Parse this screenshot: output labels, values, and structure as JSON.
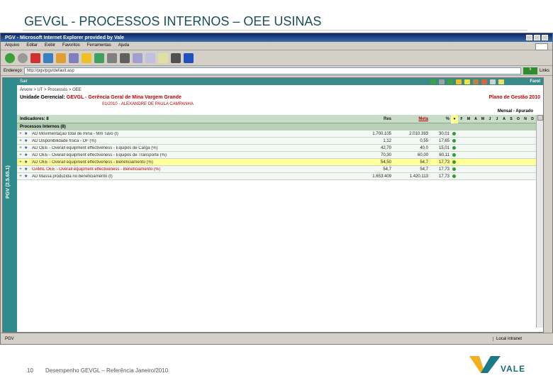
{
  "slide": {
    "title": "GEVGL - PROCESSOS INTERNOS – OEE USINAS",
    "page_number": "10",
    "footer_text": "Desempenho GEVGL – Referência Janeiro/2010",
    "logo_text": "VALE"
  },
  "browser": {
    "window_title": "PGV - Microsoft Internet Explorer provided by Vale",
    "menu": [
      "Arquivo",
      "Editar",
      "Exibir",
      "Favoritos",
      "Ferramentas",
      "Ajuda"
    ],
    "address_label": "Endereço",
    "address_value": "http://pgv/pgv/default.asp",
    "go_label": "Ir",
    "links_label": "Links",
    "status_left": "PGV",
    "status_zone": "Local intranet"
  },
  "app": {
    "side_label": "PGV (2.5.65.1)",
    "header_left": "Sair",
    "header_right": "Farol",
    "breadcrumb": "Árvore > UT > Processos > OEE",
    "unit_label": "Unidade Gerencial:",
    "unit_code": "GEVGL",
    "unit_name": "- Gerência Geral de Mina Vargem Grande",
    "person": "01/2010 - ALEXANDRE DE PAULA CAMPANHA",
    "plano": "Plano de Gestão 2010",
    "mensal": "Mensal - Apurado",
    "indicadores_label": "Indicadores: 8",
    "col_res": "Res",
    "col_meta": "Meta",
    "col_pct": "%",
    "months": [
      "F",
      "M",
      "A",
      "M",
      "J",
      "J",
      "A",
      "S",
      "O",
      "N",
      "D"
    ],
    "section_label": "Processos Internos (8)",
    "rows": [
      {
        "name": "AD Movimentação total de mina - Mm Tavo (t)",
        "res": "1.700.105",
        "meta": "2.010.393",
        "pct": "30,01",
        "red": false,
        "hl": false
      },
      {
        "name": "AD Disponibilidade física - DF (%)",
        "res": "1,12",
        "meta": "0,55",
        "pct": "17,65",
        "red": false,
        "hl": false
      },
      {
        "name": "AD OEE - Overall equipment effectiveness - Equipos de Carga (%)",
        "res": "42,70",
        "meta": "40,0",
        "pct": "15,01",
        "red": false,
        "hl": false
      },
      {
        "name": "AD OEE - Overall equipment effectiveness - Equipos de Transporte (%)",
        "res": "70,30",
        "meta": "60,00",
        "pct": "60,11",
        "red": false,
        "hl": false
      },
      {
        "name": "AD OEE - Overall equipment effectiveness - Beneficiamento (%)",
        "res": "54,50",
        "meta": "54,7",
        "pct": "17,73",
        "red": false,
        "hl": true
      },
      {
        "name": "GAMIL OEE - Overall equipment effectiveness - Beneficiamento (%)",
        "res": "54,7",
        "meta": "54,7",
        "pct": "17,73",
        "red": true,
        "hl": false
      },
      {
        "name": "AD Massa produzida no beneficiamento (t)",
        "res": "1.653.409",
        "meta": "1.420.113",
        "pct": "17,73",
        "red": false,
        "hl": false
      }
    ]
  },
  "colors": {
    "title": "#1a4d5a",
    "side_bar": "#2e8b8b",
    "status_green": "#2aa02a",
    "highlight": "#ffff99",
    "accent_red": "#c00000"
  }
}
